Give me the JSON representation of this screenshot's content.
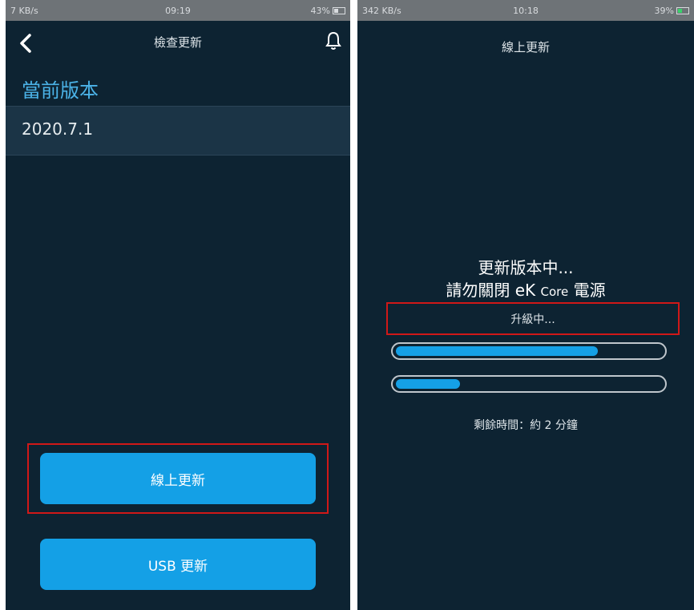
{
  "left": {
    "status": {
      "left": "7 KB/s",
      "time": "09:19",
      "battery": "43%"
    },
    "nav_title": "檢查更新",
    "section_title": "當前版本",
    "version": "2020.7.1",
    "online_update_label": "線上更新",
    "usb_update_label": "USB 更新"
  },
  "right": {
    "status": {
      "left": "342 KB/s",
      "time": "10:18",
      "battery": "39%"
    },
    "title": "線上更新",
    "message_line1": "更新版本中...",
    "message_line2_prefix": "請勿關閉 eK",
    "message_line2_core": "Core",
    "message_line2_suffix": "電源",
    "upgrading_label": "升級中...",
    "progress": [
      0.76,
      0.24
    ],
    "remaining": "剩餘時間：約 2 分鐘"
  },
  "colors": {
    "background": "#0d2332",
    "accent": "#14a0e6",
    "highlight": "#d01818"
  },
  "icons": {
    "back": "chevron-left-icon",
    "bell": "bell-icon"
  }
}
